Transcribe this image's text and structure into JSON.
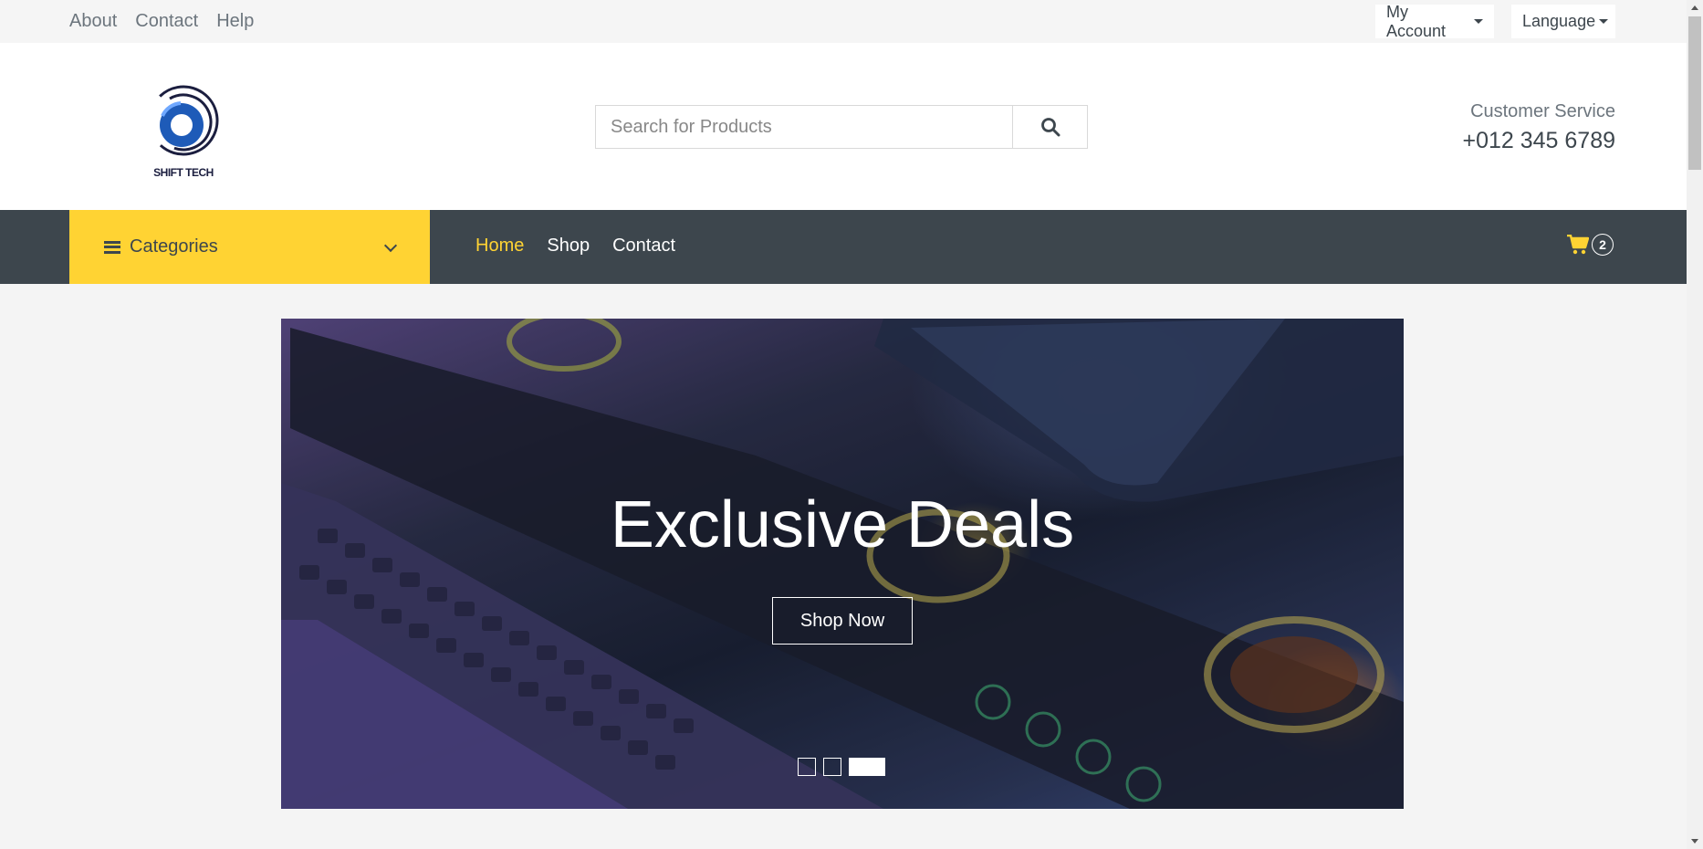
{
  "topbar": {
    "links": [
      "About",
      "Contact",
      "Help"
    ],
    "account_label": "My Account",
    "language_label": "Language"
  },
  "header": {
    "logo_text": "SHIFT TECH",
    "search_placeholder": "Search for Products",
    "customer_service_label": "Customer Service",
    "customer_service_phone": "+012 345 6789"
  },
  "nav": {
    "categories_label": "Categories",
    "links": [
      "Home",
      "Shop",
      "Contact"
    ],
    "active_link": "Home",
    "cart_count": "2"
  },
  "hero": {
    "title": "Exclusive Deals",
    "button_label": "Shop Now",
    "slide_count": 3,
    "active_slide": 3
  },
  "colors": {
    "accent": "#ffd333",
    "dark": "#3d464d",
    "logo_blue": "#1e5bb8"
  },
  "icons": [
    "bars-icon",
    "chevron-down-icon",
    "search-icon",
    "cart-icon",
    "caret-down-icon"
  ]
}
